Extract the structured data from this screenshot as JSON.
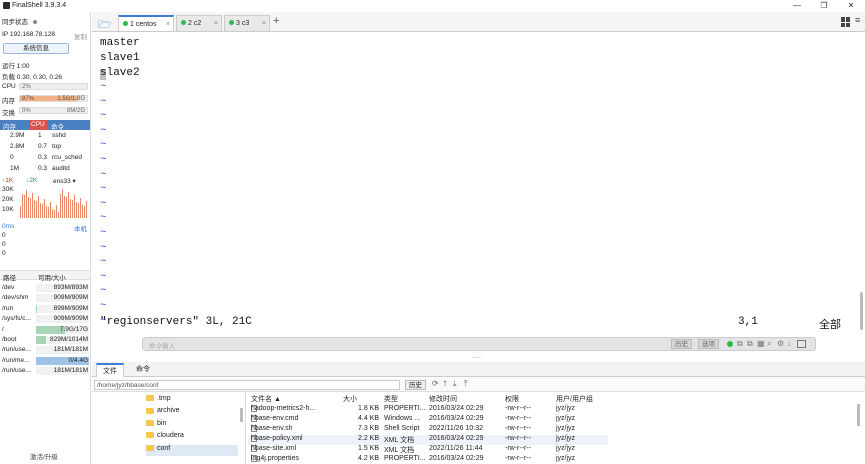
{
  "app": {
    "title": "FinalShell 3.9.3.4"
  },
  "window": {
    "minimize": "—",
    "restore": "❐",
    "close": "✕"
  },
  "left": {
    "sync_label": "同步状态",
    "ip_label": "IP 192.168.78.128",
    "copy_label": "复制",
    "sysinfo_btn": "系统信息",
    "uptime": "运行 1:00",
    "load": "负载 0.30, 0.30, 0.26",
    "cpu_label": "CPU",
    "cpu_value": "2%",
    "cpu_pct": 0.02,
    "mem_label": "内存",
    "mem_pct_text": "87%",
    "mem_value": "1.5G/1.8G",
    "mem_pct": 0.87,
    "swap_label": "交换",
    "swap_pct_text": "0%",
    "swap_value": "8M/2G",
    "proc_tabs": [
      "内存",
      "CPU",
      "命令"
    ],
    "processes": [
      {
        "mem": "2.9M",
        "cpu": "1",
        "cmd": "sshd"
      },
      {
        "mem": "2.8M",
        "cpu": "0.7",
        "cmd": "top"
      },
      {
        "mem": "0",
        "cpu": "0.3",
        "cmd": "rcu_sched"
      },
      {
        "mem": "1M",
        "cpu": "0.3",
        "cmd": "auditd"
      }
    ],
    "net_up": "↑1K",
    "net_down": "↓2K",
    "net_iface": "ens33",
    "net_ticks": [
      "30K",
      "20K",
      "10K"
    ],
    "latency": "0ms",
    "latency_host": "本机",
    "latency_vals": [
      "0",
      "0",
      "0"
    ],
    "disk_headers": [
      "路径",
      "可用/大小"
    ],
    "disks": [
      {
        "path": "/dev",
        "size": "893M/893M",
        "pct": 0
      },
      {
        "path": "/dev/shm",
        "size": "909M/909M",
        "pct": 0
      },
      {
        "path": "/run",
        "size": "899M/909M",
        "pct": 0.01
      },
      {
        "path": "/sys/fs/c...",
        "size": "909M/909M",
        "pct": 0
      },
      {
        "path": "/",
        "size": "7.9G/17G",
        "pct": 0.54
      },
      {
        "path": "/boot",
        "size": "829M/1014M",
        "pct": 0.18
      },
      {
        "path": "/run/use...",
        "size": "181M/181M",
        "pct": 0
      },
      {
        "path": "/run/me...",
        "size": "0/4.4G",
        "pct": 1.0
      },
      {
        "path": "/run/use...",
        "size": "181M/181M",
        "pct": 0
      }
    ],
    "activate": "激活/升级"
  },
  "tabs": [
    {
      "label": "1 centos",
      "active": true
    },
    {
      "label": "2 c2",
      "active": false
    },
    {
      "label": "3 c3",
      "active": false
    }
  ],
  "tab_close": "×",
  "tab_add": "+",
  "terminal": {
    "lines": [
      "master",
      "slave1",
      "slave2"
    ],
    "tildes": [
      "~",
      "~",
      "~",
      "~",
      "~",
      "~",
      "~",
      "~",
      "~",
      "~",
      "~",
      "~",
      "~",
      "~",
      "~",
      "~",
      "~"
    ],
    "status_file": "\"regionservers\" 3L, 21C",
    "status_pos": "3,1",
    "status_all": "全部"
  },
  "cmdbar": {
    "placeholder": "命令输入",
    "history": "历史",
    "options": "选项"
  },
  "filebrowser": {
    "tabs": [
      "文件",
      "命令"
    ],
    "path": "/home/jyz/hbase/conf",
    "history_btn": "历史",
    "tree": [
      ".tmp",
      "archive",
      "bin",
      "cloudera",
      "conf"
    ],
    "headers": [
      "文件名 ▲",
      "大小",
      "类型",
      "修改时间",
      "权限",
      "用户/用户组"
    ],
    "files": [
      {
        "name": "hadoop-metrics2-h...",
        "size": "1.8 KB",
        "type": "PROPERTI...",
        "time": "2016/03/24 02:29",
        "perm": "-rw-r--r--",
        "owner": "jyz/jyz"
      },
      {
        "name": "hbase-env.cmd",
        "size": "4.4 KB",
        "type": "Windows ...",
        "time": "2016/03/24 02:29",
        "perm": "-rw-r--r--",
        "owner": "jyz/jyz"
      },
      {
        "name": "hbase-env.sh",
        "size": "7.3 KB",
        "type": "Shell Script",
        "time": "2022/11/26 10:32",
        "perm": "-rw-r--r--",
        "owner": "jyz/jyz"
      },
      {
        "name": "hbase-policy.xml",
        "size": "2.2 KB",
        "type": "XML 文档",
        "time": "2016/03/24 02:29",
        "perm": "-rw-r--r--",
        "owner": "jyz/jyz"
      },
      {
        "name": "hbase-site.xml",
        "size": "1.5 KB",
        "type": "XML 文档",
        "time": "2022/11/26 11:44",
        "perm": "-rw-r--r--",
        "owner": "jyz/jyz"
      },
      {
        "name": "log4j.properties",
        "size": "4.2 KB",
        "type": "PROPERTI...",
        "time": "2016/03/24 02:29",
        "perm": "-rw-r--r--",
        "owner": "jyz/jyz"
      }
    ]
  },
  "colors": {
    "accent": "#3c7bd6",
    "tilde": "#3a5fcf",
    "mem_fill": "#f4b183",
    "proc_header": "#4a7fc1",
    "cpu_tab": "#d9534f",
    "net_chart": "#e98a6b",
    "disk_fill": "#a8d5b8",
    "disk_full": "#9ec3e6"
  }
}
